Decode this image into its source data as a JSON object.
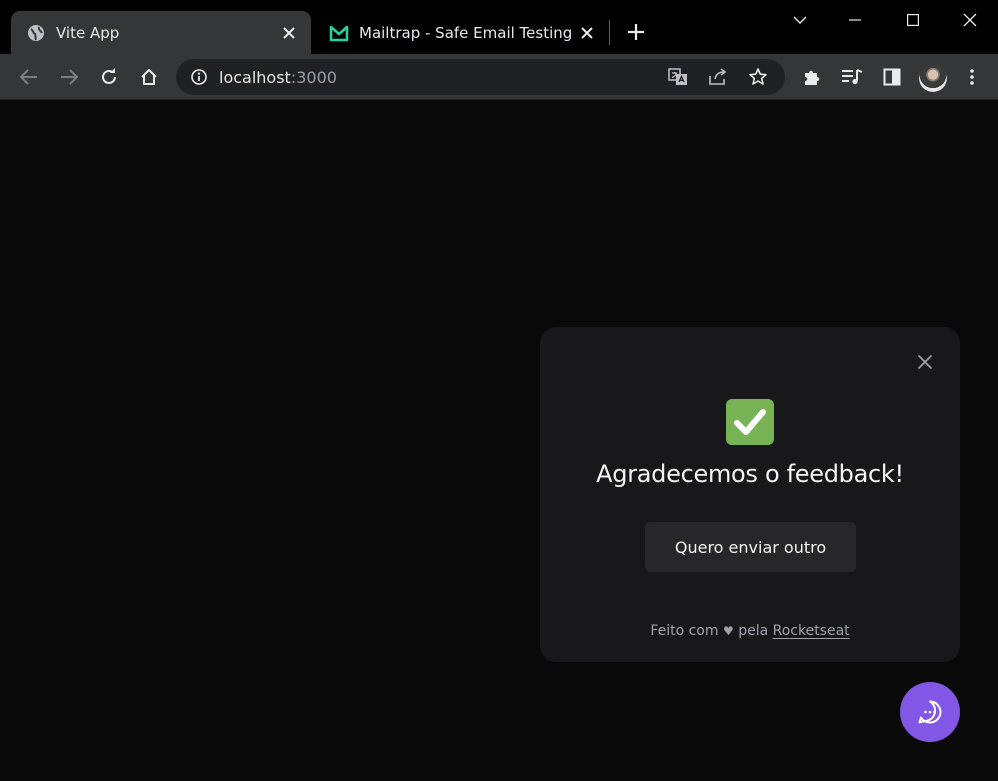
{
  "browser": {
    "tabs": [
      {
        "title": "Vite App",
        "favicon": "globe-icon",
        "active": true
      },
      {
        "title": "Mailtrap - Safe Email Testing",
        "favicon": "mailtrap-logo-icon",
        "active": false
      }
    ],
    "address": {
      "host": "localhost",
      "port": ":3000"
    }
  },
  "widget": {
    "title": "Agradecemos o feedback!",
    "again_button": "Quero enviar outro",
    "footer_prefix": "Feito com",
    "footer_heart": "♥",
    "footer_middle": "pela",
    "footer_link": "Rocketseat"
  },
  "colors": {
    "brand": "#8257e5",
    "widget_bg": "#18181b",
    "success": "#77b255"
  }
}
